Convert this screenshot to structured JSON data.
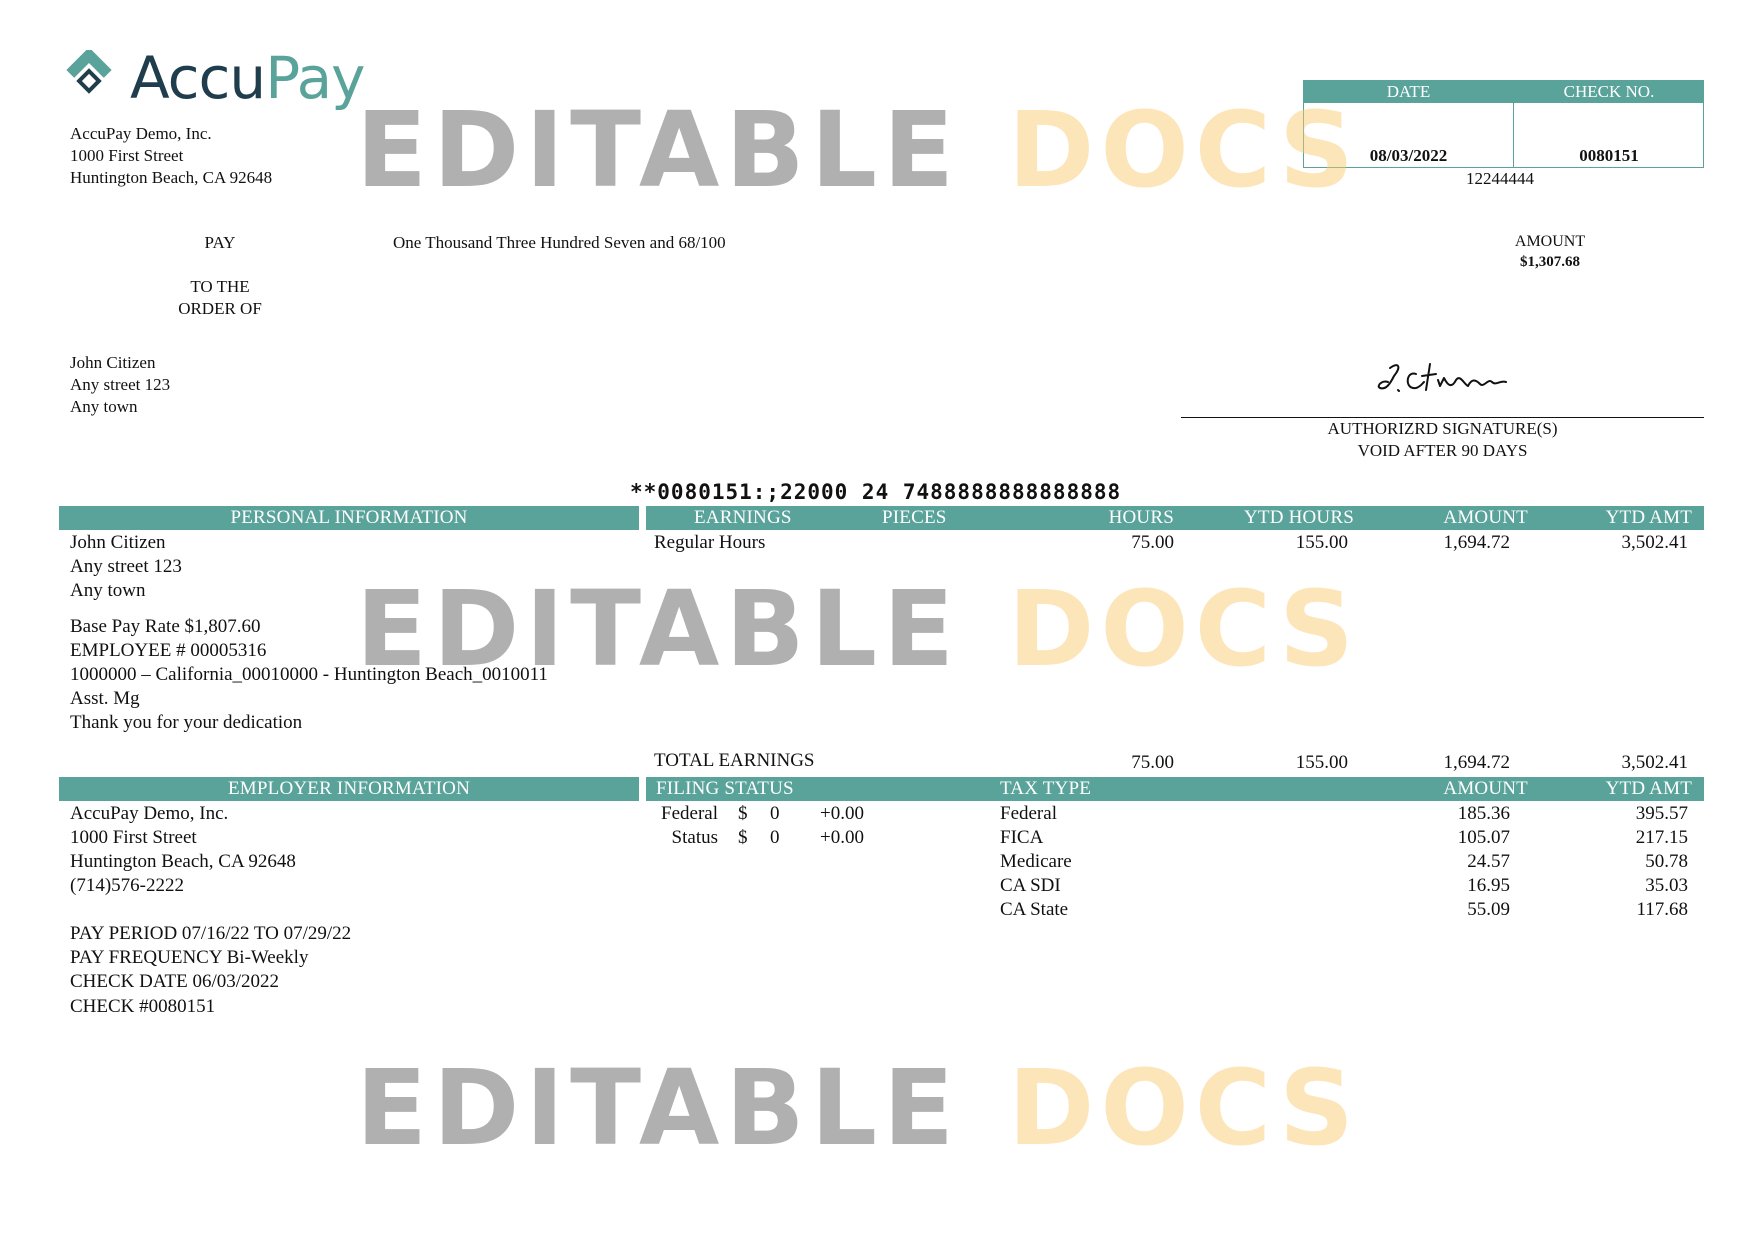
{
  "logo": {
    "word_accu": "Accu",
    "word_pay": "Pay",
    "mark_icon": "accupay-diamond-logo-icon",
    "brand_dark": "#1f3d4c",
    "brand_teal": "#5aa39b"
  },
  "company": {
    "name": "AccuPay Demo, Inc.",
    "street": "1000 First Street",
    "city": "Huntington Beach, CA 92648"
  },
  "check": {
    "date_label": "DATE",
    "checkno_label": "CHECK NO.",
    "date": "08/03/2022",
    "number": "0080151",
    "routing_ref": "12244444",
    "pay_label": "PAY",
    "amount_words": "One Thousand Three Hundred Seven and 68/100",
    "amount_label": "AMOUNT",
    "amount": "$1,307.68",
    "order_line1": "TO THE",
    "order_line2": "ORDER OF",
    "payee": [
      "John Citizen",
      "Any street 123",
      "Any town"
    ],
    "signature": "J.Citizen",
    "sig_label": "AUTHORIZRD SIGNATURE(S)",
    "void_label": "VOID AFTER 90 DAYS",
    "micr": "**0080151:;22000 24 7488888888888888"
  },
  "personal": {
    "header": "PERSONAL INFORMATION",
    "lines": [
      "John Citizen",
      "Any street 123",
      "Any town"
    ],
    "details": [
      "Base Pay Rate $1,807.60",
      "EMPLOYEE # 00005316",
      "1000000 – California_00010000 -  Huntington Beach_0010011",
      "Asst. Mg",
      "Thank you for your dedication"
    ]
  },
  "earnings": {
    "headers": {
      "earnings": "EARNINGS",
      "pieces": "PIECES",
      "hours": "HOURS",
      "ytd_hours": "YTD HOURS",
      "amount": "AMOUNT",
      "ytd_amt": "YTD AMT"
    },
    "rows": [
      {
        "label": "Regular Hours",
        "hours": "75.00",
        "ytd_hours": "155.00",
        "amount": "1,694.72",
        "ytd_amt": "3,502.41"
      }
    ],
    "total": {
      "label": "TOTAL EARNINGS",
      "hours": "75.00",
      "ytd_hours": "155.00",
      "amount": "1,694.72",
      "ytd_amt": "3,502.41"
    }
  },
  "employer": {
    "header": "EMPLOYER INFORMATION",
    "lines": [
      "AccuPay Demo, Inc.",
      "1000 First Street",
      "Huntington Beach, CA 92648",
      "(714)576-2222"
    ],
    "details": [
      "PAY PERIOD 07/16/22 TO 07/29/22",
      "PAY FREQUENCY Bi-Weekly",
      "CHECK DATE 06/03/2022",
      "CHECK #0080151"
    ]
  },
  "filing": {
    "header": "FILING STATUS",
    "rows": [
      {
        "label": "Federal",
        "dollar": "$",
        "count": "0",
        "extra": "+0.00"
      },
      {
        "label": "Status",
        "dollar": "$",
        "count": "0",
        "extra": "+0.00"
      }
    ]
  },
  "taxes": {
    "headers": {
      "type": "TAX TYPE",
      "amount": "AMOUNT",
      "ytd_amt": "YTD AMT"
    },
    "rows": [
      {
        "type": "Federal",
        "amount": "185.36",
        "ytd_amt": "395.57"
      },
      {
        "type": "FICA",
        "amount": "105.07",
        "ytd_amt": "217.15"
      },
      {
        "type": "Medicare",
        "amount": "24.57",
        "ytd_amt": "50.78"
      },
      {
        "type": "CA SDI",
        "amount": "16.95",
        "ytd_amt": "35.03"
      },
      {
        "type": "CA State",
        "amount": "55.09",
        "ytd_amt": "117.68"
      }
    ]
  },
  "watermark": {
    "word1": "EDITABLE",
    "word2": "DOCS"
  }
}
